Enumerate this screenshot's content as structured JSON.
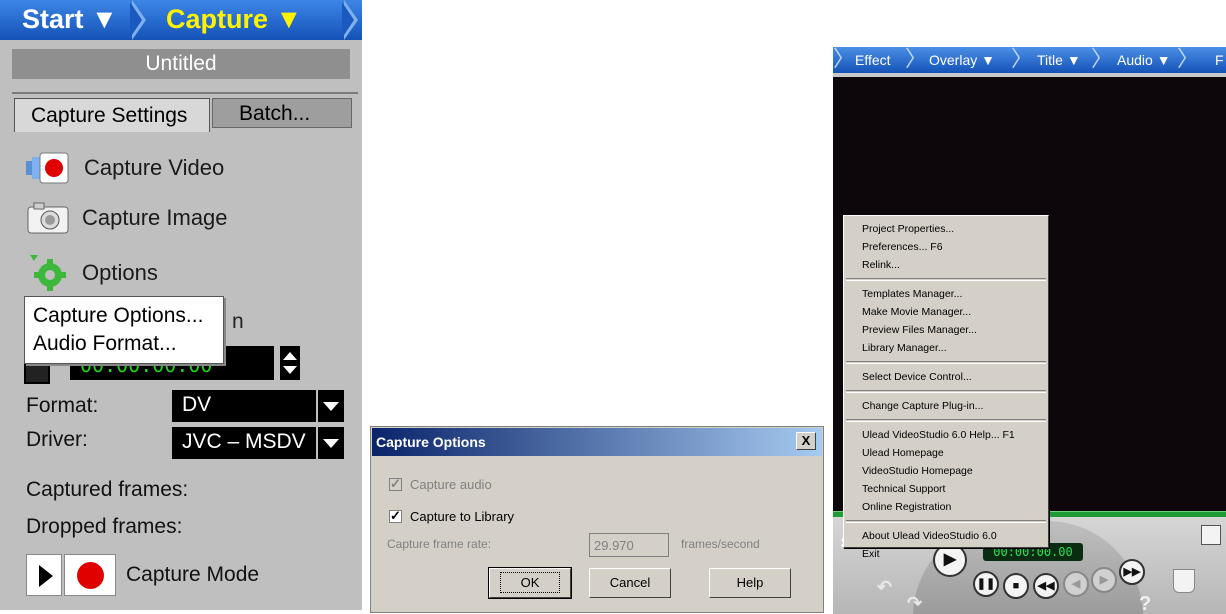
{
  "left_panel": {
    "steps": {
      "start": "Start ▼",
      "capture": "Capture ▼"
    },
    "project_title": "Untitled",
    "tabs": {
      "capture_settings": "Capture Settings",
      "batch": "Batch..."
    },
    "actions": {
      "capture_video": "Capture Video",
      "capture_image": "Capture Image",
      "options": "Options"
    },
    "options_menu": {
      "capture_options": "Capture Options...",
      "audio_format": "Audio Format..."
    },
    "hidden_text": "n",
    "timecode": "00:00:00:00",
    "format_label": "Format:",
    "format_value": "DV",
    "driver_label": "Driver:",
    "driver_value": "JVC – MSDV",
    "captured_frames_label": "Captured frames:",
    "dropped_frames_label": "Dropped frames:",
    "capture_mode_label": "Capture Mode"
  },
  "dialog": {
    "title": "Capture Options",
    "close": "X",
    "capture_audio": "Capture audio",
    "capture_audio_checked": true,
    "capture_audio_enabled": false,
    "capture_to_library": "Capture to Library",
    "capture_to_library_checked": true,
    "frame_rate_label": "Capture frame rate:",
    "frame_rate_value": "29.970",
    "frame_rate_unit": "frames/second",
    "ok": "OK",
    "cancel": "Cancel",
    "help": "Help"
  },
  "right_panel": {
    "steps": [
      "Effect",
      "Overlay ▼",
      "Title ▼",
      "Audio ▼",
      "F"
    ],
    "timecode": "00:00:00.00",
    "menu": [
      [
        "Project Properties...",
        "Preferences... F6",
        "Relink..."
      ],
      [
        "Templates Manager...",
        "Make Movie Manager...",
        "Preview Files Manager...",
        "Library Manager..."
      ],
      [
        "Select Device Control..."
      ],
      [
        "Change Capture Plug-in..."
      ],
      [
        "Ulead VideoStudio 6.0 Help... F1",
        "Ulead Homepage",
        "VideoStudio Homepage",
        "Technical Support",
        "Online Registration"
      ],
      [
        "About Ulead VideoStudio 6.0",
        "Exit"
      ]
    ]
  }
}
